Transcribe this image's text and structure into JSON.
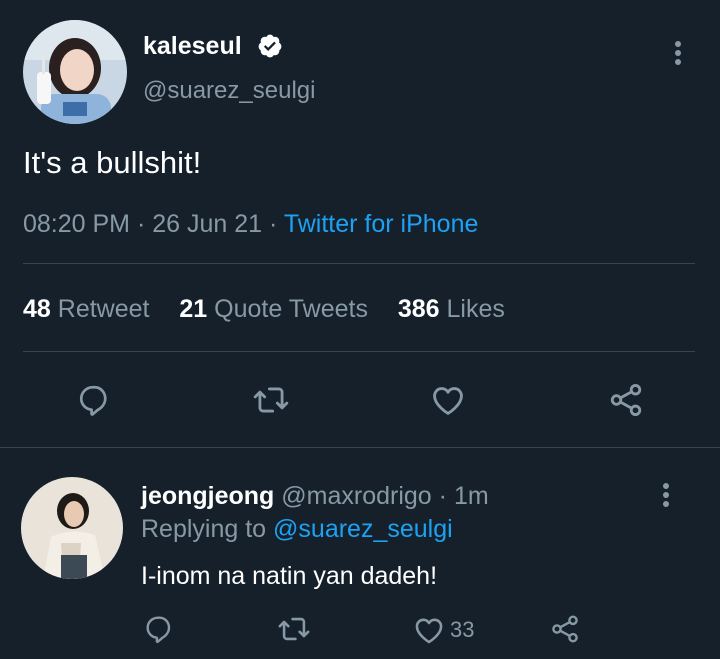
{
  "tweet": {
    "display_name": "kaleseul",
    "handle": "@suarez_seulgi",
    "text": "It's a bullshit!",
    "time": "08:20 PM",
    "date": "26 Jun 21",
    "source": "Twitter for iPhone",
    "verified": true,
    "stats": {
      "retweets_count": "48",
      "retweets_label": "Retweet",
      "quotes_count": "21",
      "quotes_label": "Quote Tweets",
      "likes_count": "386",
      "likes_label": "Likes"
    }
  },
  "reply": {
    "display_name": "jeongjeong",
    "handle": "@maxrodrigo",
    "age": "1m",
    "replying_prefix": "Replying to",
    "replying_handle": "@suarez_seulgi",
    "text": "I-inom na natin yan dadeh!",
    "like_count": "33"
  },
  "colors": {
    "background": "#15202b",
    "muted": "#8899a6",
    "accent": "#1da1f2",
    "divider": "#38444d"
  },
  "icons": {
    "verified": "verified-badge-icon",
    "more": "more-vertical-icon",
    "reply": "reply-icon",
    "retweet": "retweet-icon",
    "like": "heart-icon",
    "share": "share-icon"
  }
}
